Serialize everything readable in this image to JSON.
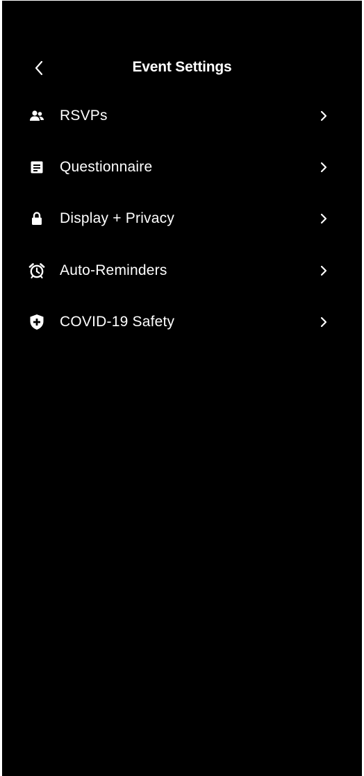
{
  "header": {
    "title": "Event Settings",
    "back_icon": "chevron-left-icon"
  },
  "menu": {
    "items": [
      {
        "label": "RSVPs",
        "icon": "people-icon"
      },
      {
        "label": "Questionnaire",
        "icon": "form-icon"
      },
      {
        "label": "Display + Privacy",
        "icon": "lock-icon"
      },
      {
        "label": "Auto-Reminders",
        "icon": "alarm-clock-icon"
      },
      {
        "label": "COVID-19 Safety",
        "icon": "shield-plus-icon"
      }
    ],
    "chevron_icon": "chevron-right-icon"
  },
  "colors": {
    "background": "#000000",
    "text": "#ffffff"
  }
}
